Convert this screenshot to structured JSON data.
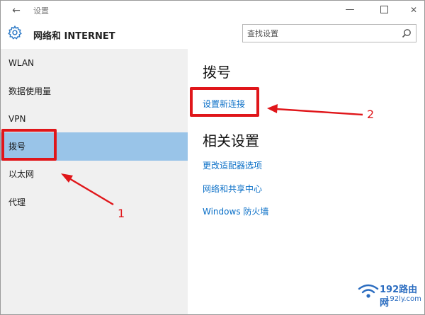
{
  "window": {
    "title": "设置",
    "back_icon": "back-arrow-icon",
    "minimize_icon": "minimize-icon",
    "maximize_icon": "maximize-icon",
    "close_icon": "close-icon"
  },
  "header": {
    "icon": "gear-icon",
    "title": "网络和 INTERNET",
    "search_placeholder": "查找设置",
    "search_value": "",
    "search_icon": "search-icon"
  },
  "sidebar": {
    "items": [
      {
        "label": "WLAN"
      },
      {
        "label": "数据使用量"
      },
      {
        "label": "VPN"
      },
      {
        "label": "拨号",
        "selected": true
      },
      {
        "label": "以太网"
      },
      {
        "label": "代理"
      }
    ]
  },
  "content": {
    "section_title": "拨号",
    "setup_link": "设置新连接",
    "related_title": "相关设置",
    "related_links": [
      "更改适配器选项",
      "网络和共享中心",
      "Windows 防火墙"
    ]
  },
  "annotations": {
    "label_1": "1",
    "label_2": "2",
    "color": "#e0161a"
  },
  "watermark": {
    "brand": "192路由网",
    "url": "192ly.com"
  },
  "colors": {
    "sidebar_bg": "#f0f0f0",
    "selected_bg": "#99c4e8",
    "link": "#0a6fc7"
  }
}
